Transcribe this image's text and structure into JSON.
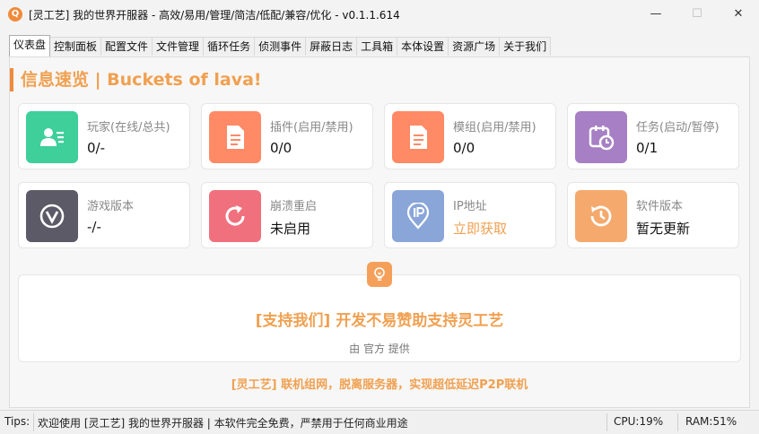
{
  "window": {
    "icon_glyph": "Q",
    "title": "[灵工艺] 我的世界开服器 - 高效/易用/管理/简洁/低配/兼容/优化 - v0.1.1.614",
    "minimize": "—",
    "maximize": "☐",
    "close": "✕"
  },
  "tabs": [
    {
      "label": "仪表盘",
      "active": true
    },
    {
      "label": "控制面板"
    },
    {
      "label": "配置文件"
    },
    {
      "label": "文件管理"
    },
    {
      "label": "循环任务"
    },
    {
      "label": "侦测事件"
    },
    {
      "label": "屏蔽日志"
    },
    {
      "label": "工具箱"
    },
    {
      "label": "本体设置"
    },
    {
      "label": "资源广场"
    },
    {
      "label": "关于我们"
    }
  ],
  "header": "信息速览 | Buckets of lava!",
  "cards": [
    {
      "label": "玩家(在线/总共)",
      "value": "0/-",
      "icon": "user-card-icon",
      "color": "#3ecf9b"
    },
    {
      "label": "插件(启用/禁用)",
      "value": "0/0",
      "icon": "document-icon",
      "color": "#ff8a65"
    },
    {
      "label": "模组(启用/禁用)",
      "value": "0/0",
      "icon": "document-icon",
      "color": "#ff8a65"
    },
    {
      "label": "任务(启动/暂停)",
      "value": "0/1",
      "icon": "calendar-clock-icon",
      "color": "#a67fc4"
    },
    {
      "label": "游戏版本",
      "value": "-/-",
      "icon": "version-icon",
      "color": "#5c5a66"
    },
    {
      "label": "崩溃重启",
      "value": "未启用",
      "icon": "restart-icon",
      "color": "#f0707e"
    },
    {
      "label": "IP地址",
      "value": "立即获取",
      "icon": "ip-pin-icon",
      "color": "#8aa6d8"
    },
    {
      "label": "软件版本",
      "value": "暂无更新",
      "icon": "history-icon",
      "color": "#f5a96d"
    }
  ],
  "support": {
    "title": "[支持我们] 开发不易赞助支持灵工艺",
    "provider": "由 官方 提供"
  },
  "promo": "[灵工艺] 联机组网，脱离服务器，实现超低延迟P2P联机",
  "status": {
    "tips_label": "Tips:",
    "message": "欢迎使用 [灵工艺] 我的世界开服器 | 本软件完全免费，严禁用于任何商业用途",
    "cpu": "CPU:19%",
    "ram": "RAM:51%"
  }
}
